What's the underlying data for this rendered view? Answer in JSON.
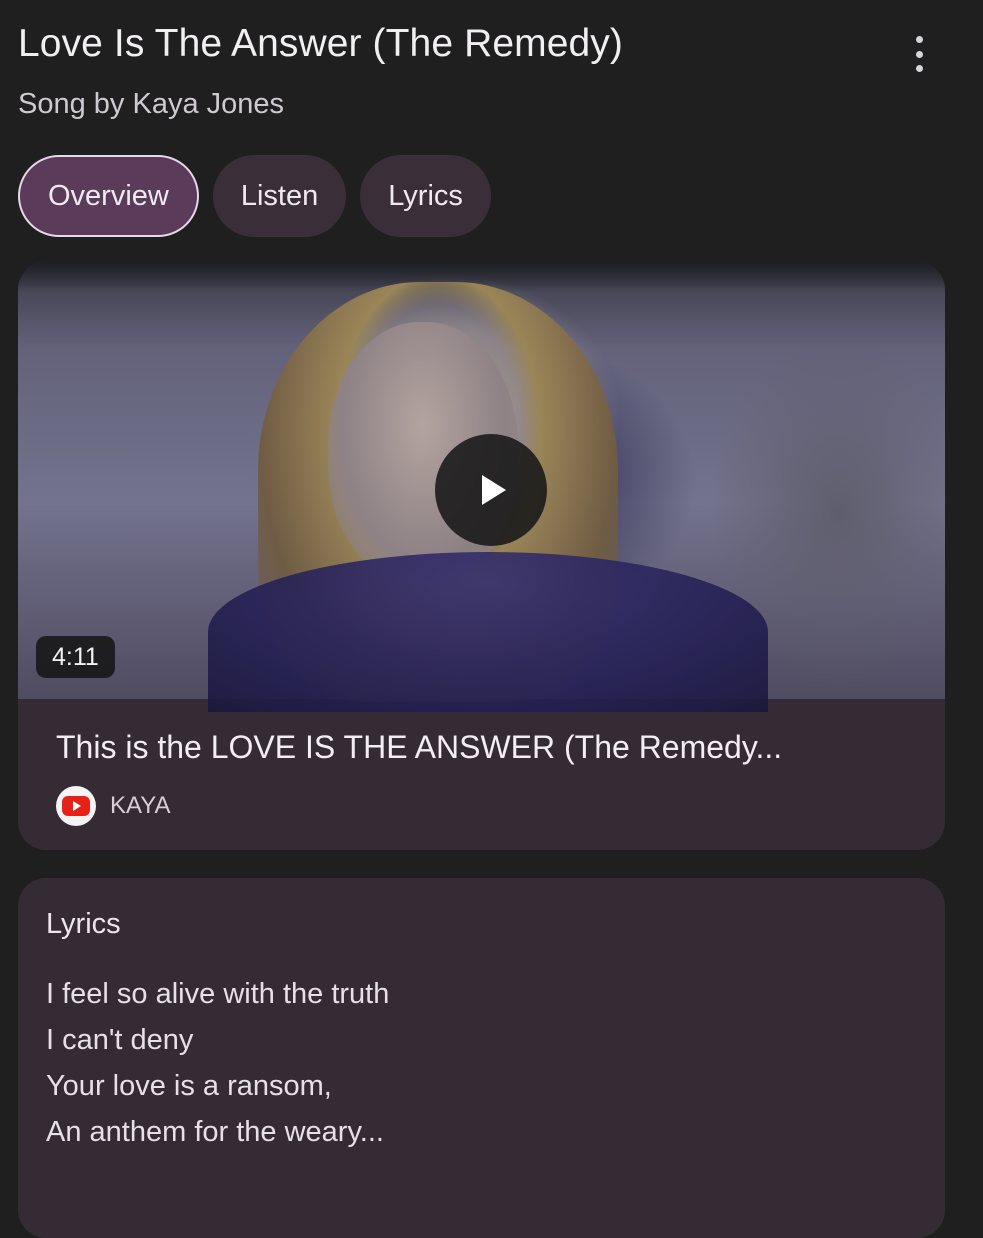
{
  "header": {
    "title": "Love Is The Answer (The Remedy)",
    "subtitle": "Song by Kaya Jones"
  },
  "tabs": [
    {
      "label": "Overview",
      "active": true
    },
    {
      "label": "Listen",
      "active": false
    },
    {
      "label": "Lyrics",
      "active": false
    }
  ],
  "video": {
    "duration": "4:11",
    "title": "This is the LOVE IS THE ANSWER (The Remedy...",
    "channel": "KAYA",
    "source_icon": "youtube-icon"
  },
  "lyrics": {
    "heading": "Lyrics",
    "lines": [
      "I feel so alive with the truth",
      "I can't deny",
      "Your love is a ransom,",
      "An anthem for the weary..."
    ]
  },
  "colors": {
    "background": "#1f1f1f",
    "card": "#352b34",
    "active_tab": "#5a3b59",
    "inactive_tab": "#3a2f39",
    "youtube_red": "#e62117"
  }
}
